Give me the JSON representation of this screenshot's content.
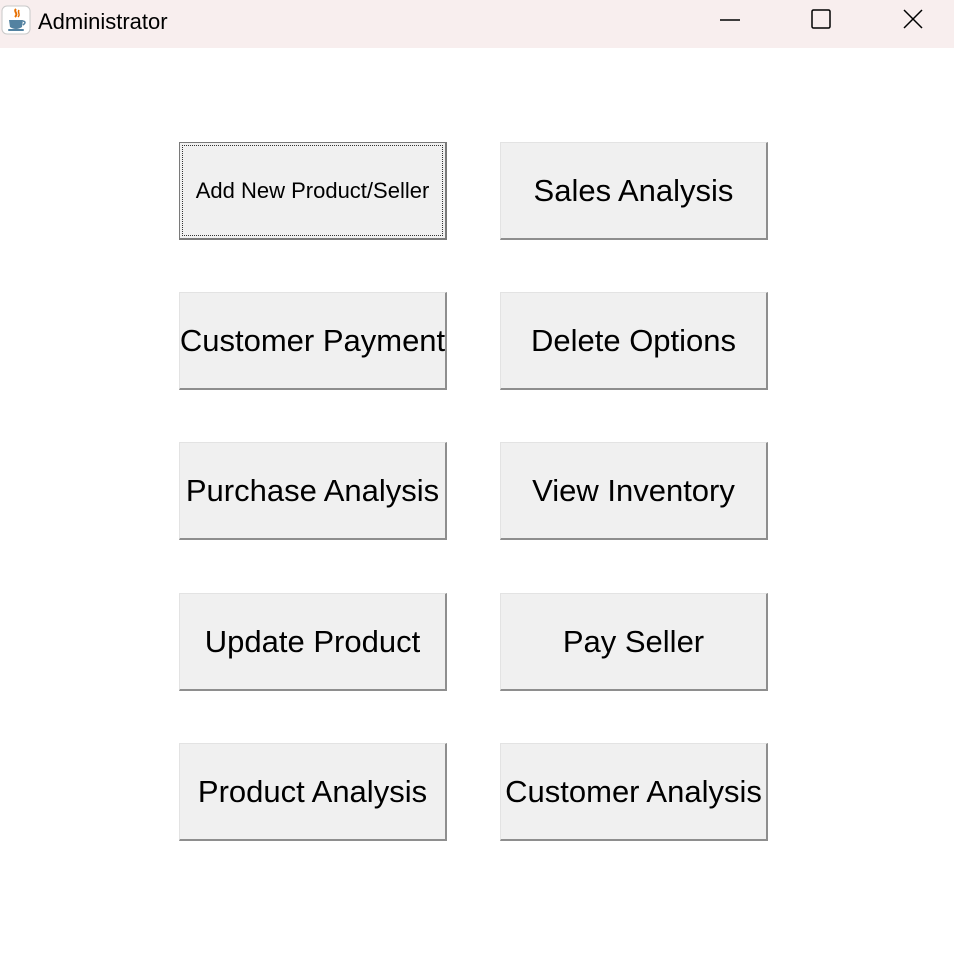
{
  "window": {
    "title": "Administrator",
    "app_icon": "java-coffee-cup-icon",
    "controls": {
      "minimize": "minimize-icon",
      "maximize": "maximize-icon",
      "close": "close-icon"
    },
    "titlebar_color": "#f8eeee"
  },
  "buttons": {
    "add_new_product_seller": "Add New Product/Seller",
    "sales_analysis": "Sales Analysis",
    "customer_payment": "Customer Payment",
    "delete_options": "Delete Options",
    "purchase_analysis": "Purchase Analysis",
    "view_inventory": "View Inventory",
    "update_product": "Update Product",
    "pay_seller": "Pay Seller",
    "product_analysis": "Product Analysis",
    "customer_analysis": "Customer Analysis"
  },
  "colors": {
    "button_face": "#f0f0f0",
    "button_shadow": "#8e8e8e",
    "background": "#ffffff"
  }
}
